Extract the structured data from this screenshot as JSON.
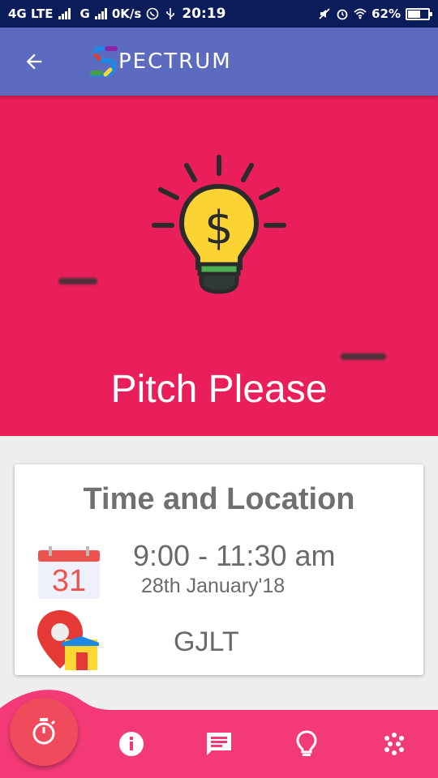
{
  "status_bar": {
    "network_left": "4G LTE",
    "network_right": "G",
    "speed": "0K/s",
    "time": "20:19",
    "battery": "62%",
    "battery_level": 0.62
  },
  "app_bar": {
    "logo_text": "PECTRUM",
    "back_icon": "arrow-left-icon"
  },
  "hero": {
    "title": "Pitch Please",
    "background_color": "#e91e5a",
    "illustration": "lightbulb-dollar-icon"
  },
  "card": {
    "title": "Time and Location",
    "calendar_day": "31",
    "time": "9:00 - 11:30 am",
    "date": "28th January'18",
    "venue": "GJLT"
  },
  "bottom_nav": {
    "accent_color": "#f33a77",
    "items": [
      {
        "name": "timer",
        "icon": "stopwatch-icon"
      },
      {
        "name": "info",
        "icon": "info-icon"
      },
      {
        "name": "chat",
        "icon": "chat-icon"
      },
      {
        "name": "ideas",
        "icon": "lightbulb-icon"
      },
      {
        "name": "more",
        "icon": "dots-grid-icon"
      }
    ]
  }
}
